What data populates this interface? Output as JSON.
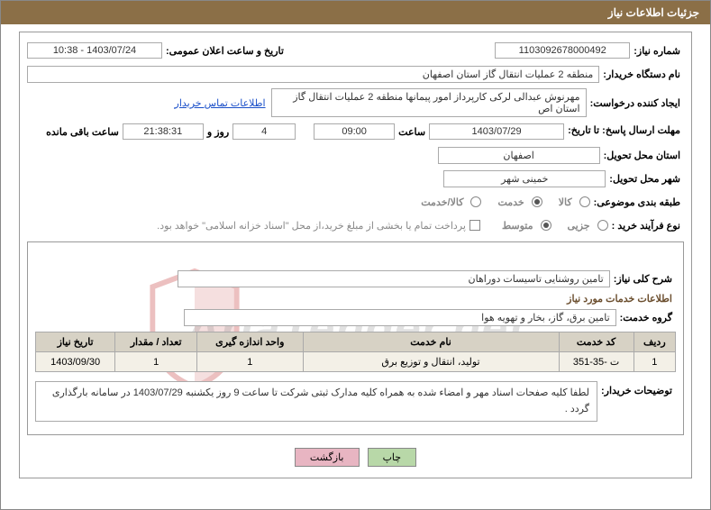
{
  "header": {
    "title": "جزئیات اطلاعات نیاز"
  },
  "fields": {
    "need_no_label": "شماره نیاز:",
    "need_no": "1103092678000492",
    "announce_label": "تاریخ و ساعت اعلان عمومی:",
    "announce_val": "1403/07/24 - 10:38",
    "buyer_org_label": "نام دستگاه خریدار:",
    "buyer_org": "منطقه 2 عملیات انتقال گاز استان اصفهان",
    "requester_label": "ایجاد کننده درخواست:",
    "requester": "مهرنوش عبدالی لرکی کارپرداز امور پیمانها منطقه 2 عملیات انتقال گاز استان اص",
    "contact_link": "اطلاعات تماس خریدار",
    "deadline_label": "مهلت ارسال پاسخ: تا تاریخ:",
    "deadline_date": "1403/07/29",
    "time_label": "ساعت",
    "deadline_time": "09:00",
    "days_val": "4",
    "days_and": "روز و",
    "remaining_time": "21:38:31",
    "remaining_label": "ساعت باقی مانده",
    "province_label": "استان محل تحویل:",
    "province": "اصفهان",
    "city_label": "شهر محل تحویل:",
    "city": "خمینی شهر",
    "category_label": "طبقه بندی موضوعی:",
    "cat_goods": "کالا",
    "cat_service": "خدمت",
    "cat_goods_service": "کالا/خدمت",
    "purchase_type_label": "نوع فرآیند خرید :",
    "pt_minor": "جزیی",
    "pt_medium": "متوسط",
    "note_checkbox": "پرداخت تمام یا بخشی از مبلغ خرید،از محل \"اسناد خزانه اسلامی\" خواهد بود."
  },
  "inner": {
    "overall_label": "شرح کلی نیاز:",
    "overall_value": "تامین روشنایی تاسیسات دوراهان",
    "services_header": "اطلاعات خدمات مورد نیاز",
    "group_label": "گروه خدمت:",
    "group_value": "تامین برق، گاز، بخار و تهویه هوا",
    "table": {
      "headers": [
        "ردیف",
        "کد خدمت",
        "نام خدمت",
        "واحد اندازه گیری",
        "تعداد / مقدار",
        "تاریخ نیاز"
      ],
      "rows": [
        {
          "c0": "1",
          "c1": "ت -35-351",
          "c2": "تولید، انتقال و توزیع برق",
          "c3": "1",
          "c4": "1",
          "c5": "1403/09/30"
        }
      ]
    },
    "buyer_note_label": "توضیحات خریدار:",
    "buyer_note": "لطفا کلیه صفحات اسناد مهر و امضاء شده به همراه کلیه مدارک ثبتی شرکت تا ساعت 9 روز یکشنبه 1403/07/29 در سامانه بارگذاری گردد ."
  },
  "buttons": {
    "print": "چاپ",
    "back": "بازگشت"
  },
  "watermark": {
    "text": "AriaTender.net"
  }
}
